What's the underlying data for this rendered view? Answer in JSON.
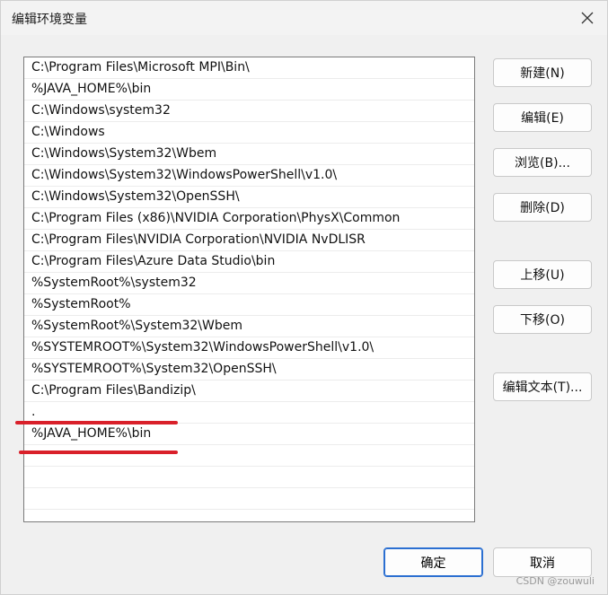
{
  "window": {
    "title": "编辑环境变量"
  },
  "list": {
    "items": [
      "C:\\Program Files\\Microsoft MPI\\Bin\\",
      "%JAVA_HOME%\\bin",
      "C:\\Windows\\system32",
      "C:\\Windows",
      "C:\\Windows\\System32\\Wbem",
      "C:\\Windows\\System32\\WindowsPowerShell\\v1.0\\",
      "C:\\Windows\\System32\\OpenSSH\\",
      "C:\\Program Files (x86)\\NVIDIA Corporation\\PhysX\\Common",
      "C:\\Program Files\\NVIDIA Corporation\\NVIDIA NvDLISR",
      "C:\\Program Files\\Azure Data Studio\\bin",
      "%SystemRoot%\\system32",
      "%SystemRoot%",
      "%SystemRoot%\\System32\\Wbem",
      "%SYSTEMROOT%\\System32\\WindowsPowerShell\\v1.0\\",
      "%SYSTEMROOT%\\System32\\OpenSSH\\",
      "C:\\Program Files\\Bandizip\\",
      ".",
      "%JAVA_HOME%\\bin",
      "",
      "",
      "",
      ""
    ]
  },
  "buttons": {
    "new": "新建(N)",
    "edit": "编辑(E)",
    "browse": "浏览(B)...",
    "delete": "删除(D)",
    "move_up": "上移(U)",
    "move_down": "下移(O)",
    "edit_text": "编辑文本(T)...",
    "ok": "确定",
    "cancel": "取消"
  },
  "annotation": {
    "color": "#d9202a"
  },
  "watermark": "CSDN @zouwuli"
}
